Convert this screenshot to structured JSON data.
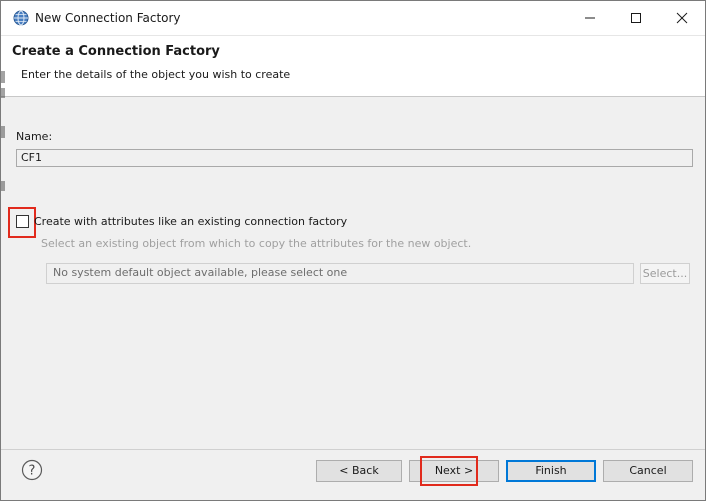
{
  "window": {
    "title": "New Connection Factory"
  },
  "header": {
    "title": "Create a Connection Factory",
    "description": "Enter the details of the object you wish to create"
  },
  "form": {
    "name_label": "Name:",
    "name_value": "CF1",
    "checkbox_label": "Create with attributes like an existing connection factory",
    "checkbox_checked": false,
    "copy_description": "Select an existing object from which to copy the attributes for the new object.",
    "existing_object_value": "No system default object available, please select one",
    "select_button_label": "Select..."
  },
  "footer": {
    "back_label": "< Back",
    "next_label": "Next >",
    "finish_label": "Finish",
    "cancel_label": "Cancel"
  },
  "colors": {
    "highlight": "#e12a1c",
    "default_button_border": "#0078d7"
  },
  "icons": {
    "app": "globe-icon",
    "help": "help-icon"
  }
}
